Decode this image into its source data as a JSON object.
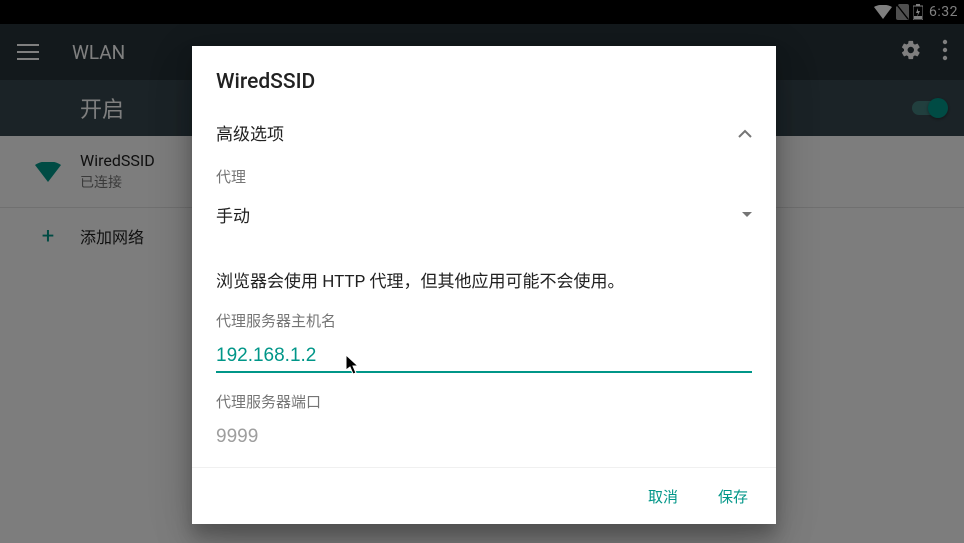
{
  "statusbar": {
    "time": "6:32"
  },
  "appbar": {
    "title": "WLAN"
  },
  "enable_row": {
    "label": "开启"
  },
  "wifi_list": {
    "item": {
      "ssid": "WiredSSID",
      "status": "已连接"
    },
    "add_label": "添加网络"
  },
  "dialog": {
    "title": "WiredSSID",
    "advanced_label": "高级选项",
    "proxy_section_label": "代理",
    "proxy_mode_value": "手动",
    "proxy_hint": "浏览器会使用 HTTP 代理，但其他应用可能不会使用。",
    "hostname_label": "代理服务器主机名",
    "hostname_value": "192.168.1.2",
    "port_label": "代理服务器端口",
    "port_value": "9999",
    "cancel": "取消",
    "save": "保存"
  }
}
